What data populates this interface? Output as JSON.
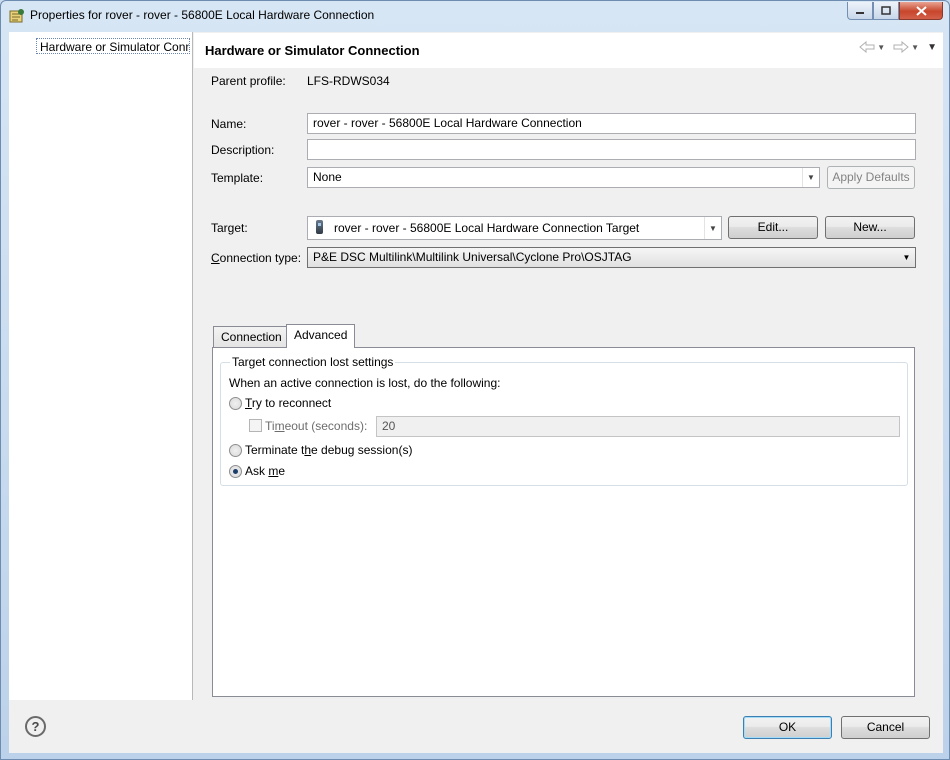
{
  "window": {
    "title": "Properties for rover - rover - 56800E Local Hardware Connection",
    "icon": "eclipse-properties-icon"
  },
  "nav": {
    "items": [
      {
        "label": "Hardware or Simulator Conn"
      }
    ]
  },
  "page": {
    "title": "Hardware or Simulator Connection"
  },
  "form": {
    "parent_profile_label": "Parent profile:",
    "parent_profile_value": "LFS-RDWS034",
    "name_label": "Name:",
    "name_value": "rover - rover - 56800E Local Hardware Connection",
    "description_label": "Description:",
    "description_value": "",
    "template_label": "Template:",
    "template_value": "None",
    "apply_defaults_label": "Apply Defaults",
    "target_label": "Target:",
    "target_value": "rover - rover - 56800E Local Hardware Connection Target",
    "edit_label": "Edit...",
    "new_label": "New...",
    "connection_type_label_pre": "",
    "connection_type_label_u": "C",
    "connection_type_label_post": "onnection type:",
    "connection_type_value": "P&E DSC Multilink\\Multilink Universal\\Cyclone Pro\\OSJTAG"
  },
  "tabs": [
    {
      "label": "Connection"
    },
    {
      "label": "Advanced",
      "active": true
    }
  ],
  "advanced": {
    "group_title": "Target connection lost settings",
    "instruction": "When an active connection is lost, do the following:",
    "try_reconnect_u": "T",
    "try_reconnect_rest": "ry to reconnect",
    "timeout_pre": "Ti",
    "timeout_u": "m",
    "timeout_post": "eout (seconds):",
    "timeout_value": "20",
    "terminate_pre": "Terminate t",
    "terminate_u": "h",
    "terminate_post": "e debug session(s)",
    "ask_pre": "Ask ",
    "ask_u": "m",
    "ask_post": "e",
    "selected_option": "ask_me"
  },
  "footer": {
    "ok_label": "OK",
    "cancel_label": "Cancel"
  }
}
